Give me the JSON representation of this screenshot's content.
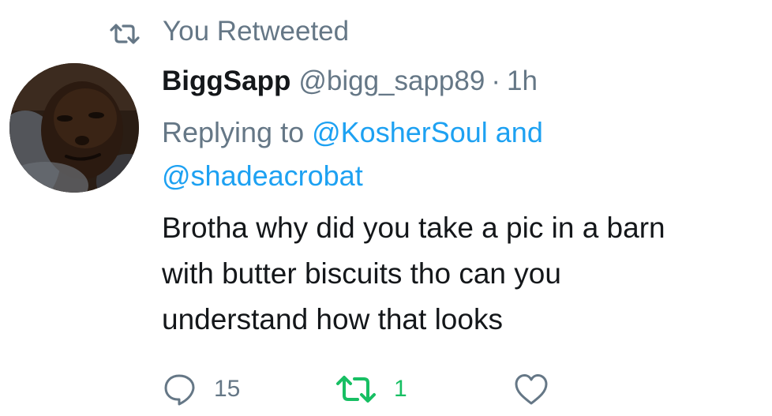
{
  "context": {
    "retweet_label": "You Retweeted",
    "icon": "retweet-icon",
    "color": "#657786"
  },
  "tweet": {
    "display_name": "BiggSapp",
    "handle": "@bigg_sapp89",
    "separator": "·",
    "time": "1h",
    "reply_prefix": "Replying to ",
    "reply_mentions": [
      "@KosherSoul",
      "@shadeacrobat"
    ],
    "reply_joiner": " and ",
    "text": "Brotha why did you take a pic in a barn\nwith butter biscuits tho can you\nunderstand how that looks"
  },
  "actions": {
    "reply": {
      "icon": "reply-icon",
      "count": "15",
      "color": "#657786"
    },
    "retweet": {
      "icon": "retweet-icon",
      "count": "1",
      "active": true,
      "color": "#17bf63"
    },
    "like": {
      "icon": "heart-icon",
      "count": "",
      "color": "#657786"
    }
  },
  "colors": {
    "link": "#1da1f2",
    "secondary_text": "#657786",
    "primary_text": "#14171a"
  }
}
